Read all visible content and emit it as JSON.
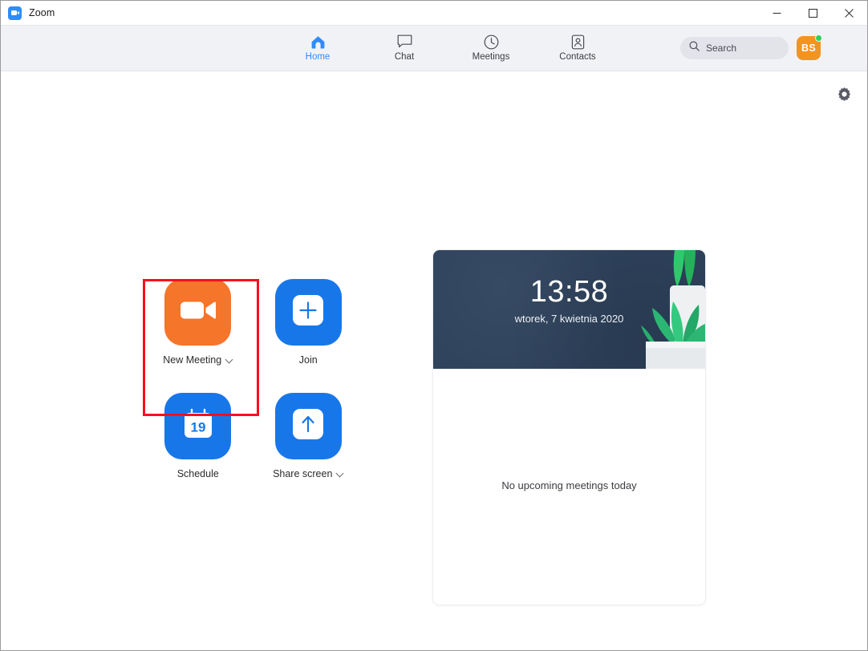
{
  "window": {
    "title": "Zoom",
    "app_icon": "zoom-camera-icon",
    "minimize_label": "Minimize",
    "maximize_label": "Maximize",
    "close_label": "Close"
  },
  "nav": {
    "tabs": [
      {
        "id": "home",
        "label": "Home",
        "icon": "home-icon",
        "active": true
      },
      {
        "id": "chat",
        "label": "Chat",
        "icon": "chat-icon",
        "active": false
      },
      {
        "id": "meetings",
        "label": "Meetings",
        "icon": "clock-icon",
        "active": false
      },
      {
        "id": "contacts",
        "label": "Contacts",
        "icon": "contacts-icon",
        "active": false
      }
    ],
    "search": {
      "placeholder": "Search",
      "icon": "search-icon"
    },
    "profile": {
      "initials": "BS",
      "status": "available",
      "status_color": "#30d158",
      "avatar_color": "#f2941f"
    }
  },
  "toolbar": {
    "settings_icon": "gear-icon"
  },
  "actions": [
    {
      "id": "new-meeting",
      "label": "New Meeting",
      "icon": "video-camera-icon",
      "color": "#f5752b",
      "has_dropdown": true,
      "highlighted": true
    },
    {
      "id": "join",
      "label": "Join",
      "icon": "plus-icon",
      "color": "#1877e8",
      "has_dropdown": false,
      "highlighted": false
    },
    {
      "id": "schedule",
      "label": "Schedule",
      "icon": "calendar-icon",
      "icon_day": "19",
      "color": "#1877e8",
      "has_dropdown": false,
      "highlighted": false
    },
    {
      "id": "share-screen",
      "label": "Share screen",
      "icon": "upload-arrow-icon",
      "color": "#1877e8",
      "has_dropdown": true,
      "highlighted": false
    }
  ],
  "highlight": {
    "color": "#fc0d1b",
    "target": "new-meeting"
  },
  "side_panel": {
    "clock": {
      "time": "13:58",
      "date": "wtorek, 7 kwietnia 2020"
    },
    "banner_color": "#2e425c",
    "illustration": "potted-plant-illustration",
    "empty_state": "No upcoming meetings today"
  }
}
